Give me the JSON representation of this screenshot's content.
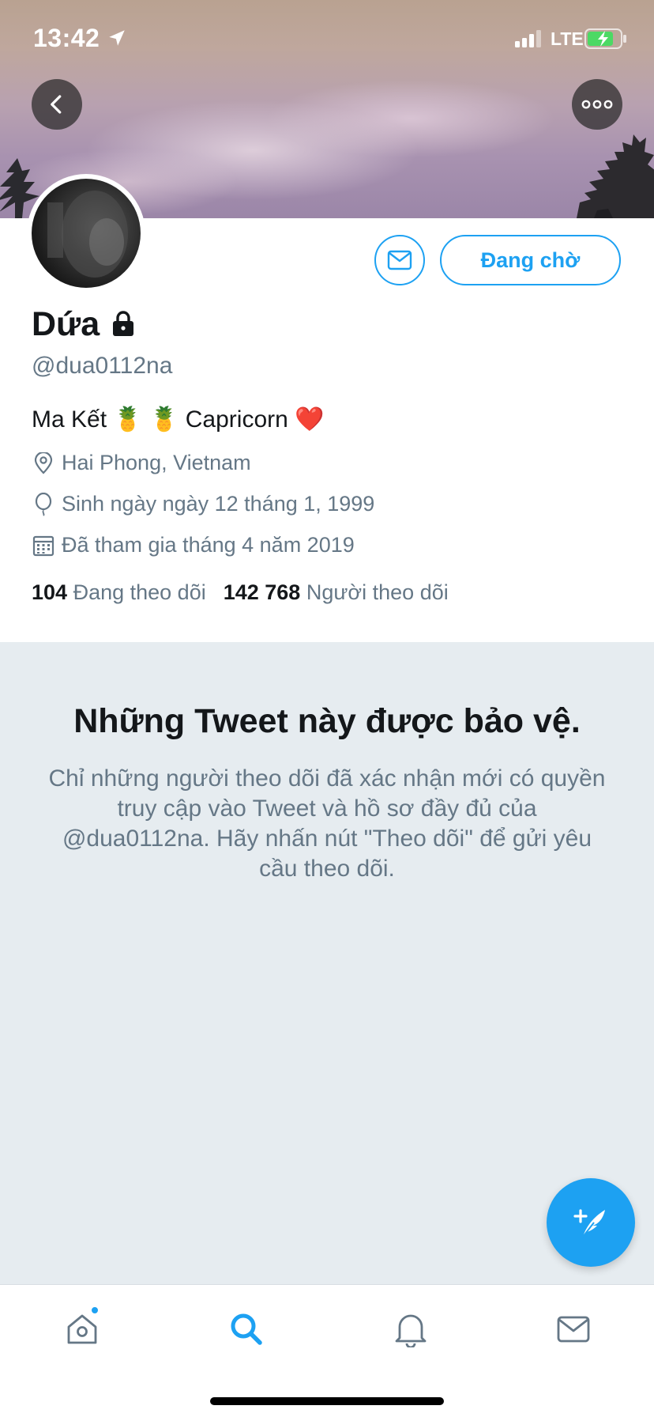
{
  "status_bar": {
    "time": "13:42",
    "network": "LTE"
  },
  "profile": {
    "display_name": "Dứa",
    "handle": "@dua0112na",
    "bio": "Ma Kết 🍍 🍍  Capricorn ❤️",
    "location": "Hai Phong, Vietnam",
    "birthday": "Sinh ngày ngày 12 tháng 1, 1999",
    "joined": "Đã tham gia tháng 4 năm 2019",
    "following_count": "104",
    "following_label": "Đang theo dõi",
    "followers_count": "142 768",
    "followers_label": "Người theo dõi"
  },
  "actions": {
    "pending_label": "Đang chờ"
  },
  "protected_notice": {
    "title": "Những Tweet này được bảo vệ.",
    "description": "Chỉ những người theo dõi đã xác nhận mới có quyền truy cập vào Tweet và hồ sơ đầy đủ của @dua0112na. Hãy nhấn nút \"Theo dõi\" để gửi yêu cầu theo dõi."
  },
  "icons": {
    "back": "chevron-left-icon",
    "more": "more-horizontal-icon",
    "message": "envelope-icon",
    "lock": "lock-icon",
    "location": "location-pin-icon",
    "birthday": "balloon-icon",
    "calendar": "calendar-icon",
    "compose": "compose-tweet-icon",
    "tab_home": "home-icon",
    "tab_search": "search-icon",
    "tab_notifications": "bell-icon",
    "tab_messages": "envelope-icon"
  },
  "colors": {
    "accent": "#1da1f2",
    "muted_text": "#657786",
    "protected_bg": "#e6ecf0"
  }
}
